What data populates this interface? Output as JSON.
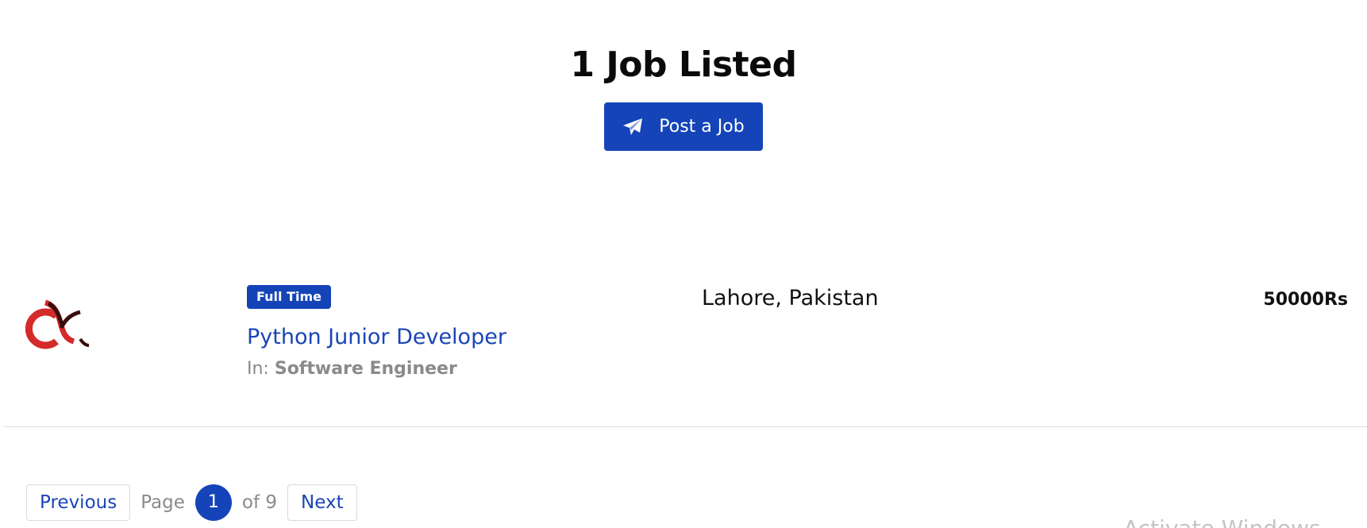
{
  "header": {
    "title": "1 Job Listed",
    "post_button_label": "Post a Job"
  },
  "jobs": [
    {
      "logo_icon": "company-logo",
      "type_badge": "Full Time",
      "title": "Python Junior Developer",
      "category_prefix": "In:",
      "category": "Software Engineer",
      "location": "Lahore, Pakistan",
      "salary": "50000Rs"
    }
  ],
  "pagination": {
    "previous_label": "Previous",
    "page_label": "Page",
    "current_page": "1",
    "of_label": "of 9",
    "next_label": "Next"
  },
  "overlay": {
    "watermark": "Activate Windows"
  },
  "colors": {
    "primary": "#1444b8",
    "link": "#1a45b5",
    "logo_red": "#d42a2a",
    "logo_dark": "#3a0d0d"
  },
  "icons": {
    "post_button_icon": "paper-plane-icon"
  }
}
